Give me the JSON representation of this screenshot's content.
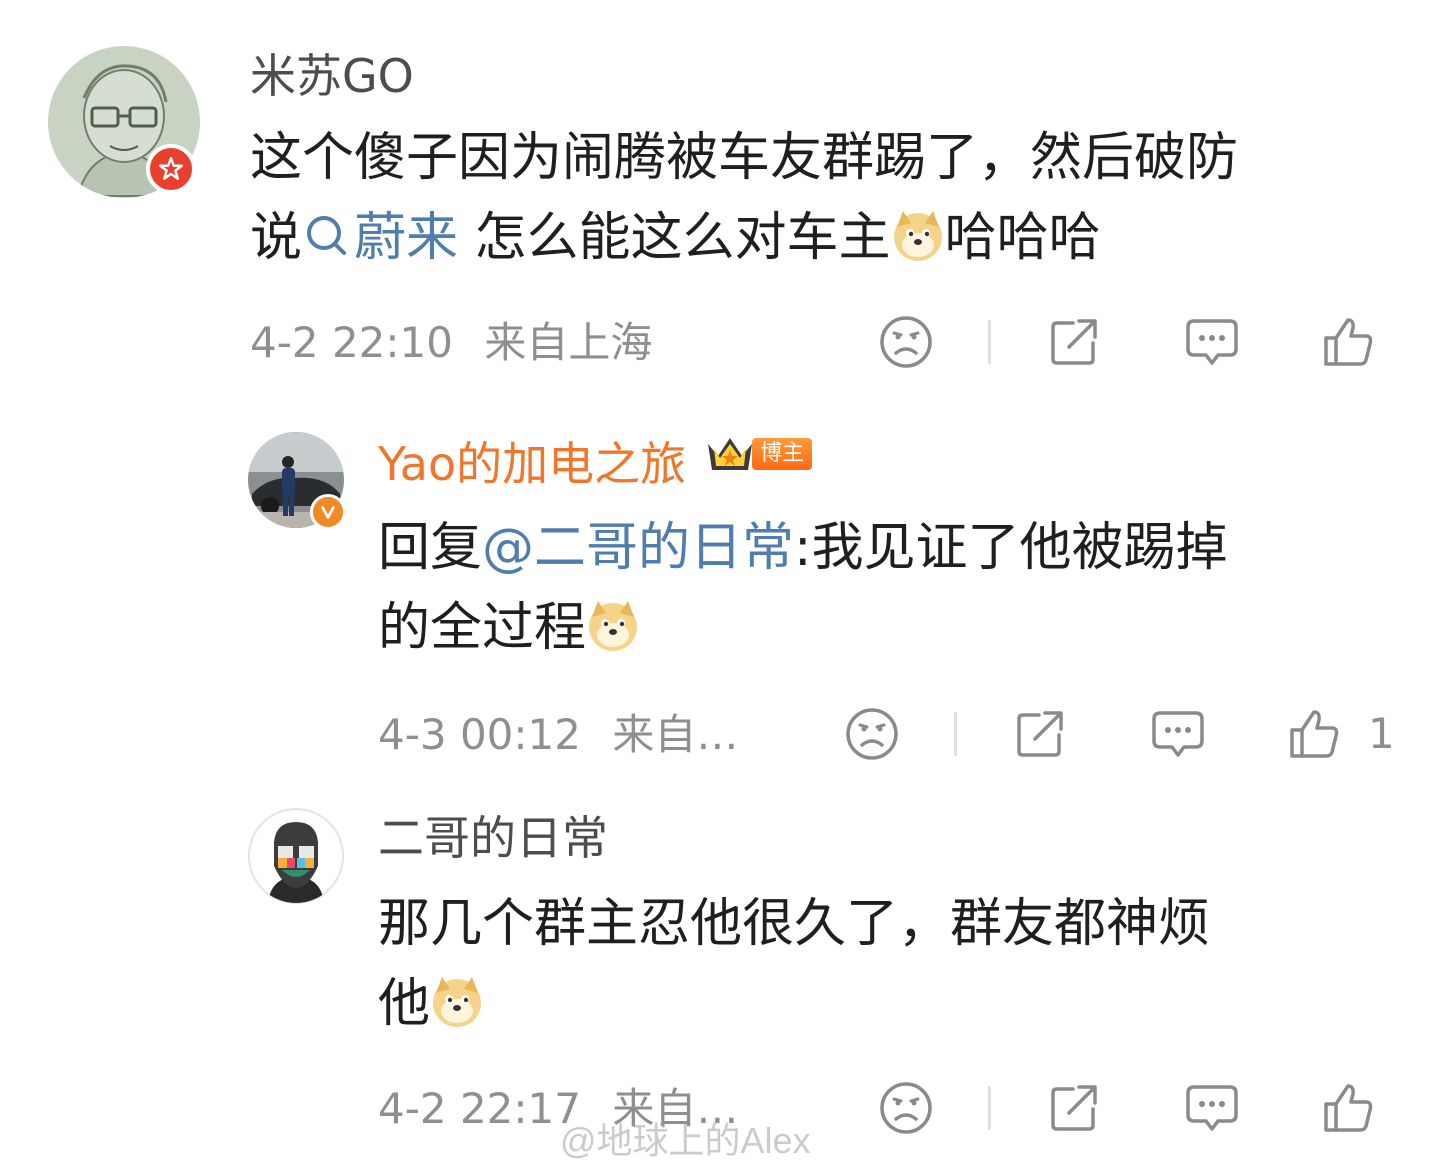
{
  "comments": [
    {
      "author": "米苏GO",
      "author_color": "#4d4d4d",
      "text_a": "这个傻子因为闹腾被车友群踢了，然后破防",
      "text_b": "说",
      "topic": "蔚来",
      "text_c": " 怎么能这么对车主",
      "text_d": "哈哈哈",
      "time": "4-2 22:10",
      "location": "来自上海"
    },
    {
      "author": "Yao的加电之旅",
      "author_color": "#f0762c",
      "author_badge": "博主",
      "reply_prefix": "回复",
      "mention": "@二哥的日常",
      "text_a": ":我见证了他被踢掉",
      "text_b": "的全过程",
      "time": "4-3 00:12",
      "location": "来自…",
      "like_count": "1"
    },
    {
      "author": "二哥的日常",
      "author_color": "#4d4d4d",
      "text_a": "那几个群主忍他很久了，群友都神烦",
      "text_b": "他",
      "time": "4-2 22:17",
      "location": "来自…"
    }
  ],
  "watermark": "@地球上的Alex",
  "icons": [
    "sad-face-icon",
    "share-icon",
    "comment-icon",
    "thumbs-up-icon",
    "search-icon",
    "doge-emoji-icon",
    "crown-icon",
    "verified-v-icon",
    "red-star-badge-icon"
  ],
  "colors": {
    "link": "#507daf",
    "meta": "#8f8f8f",
    "accent_orange": "#f0762c"
  }
}
